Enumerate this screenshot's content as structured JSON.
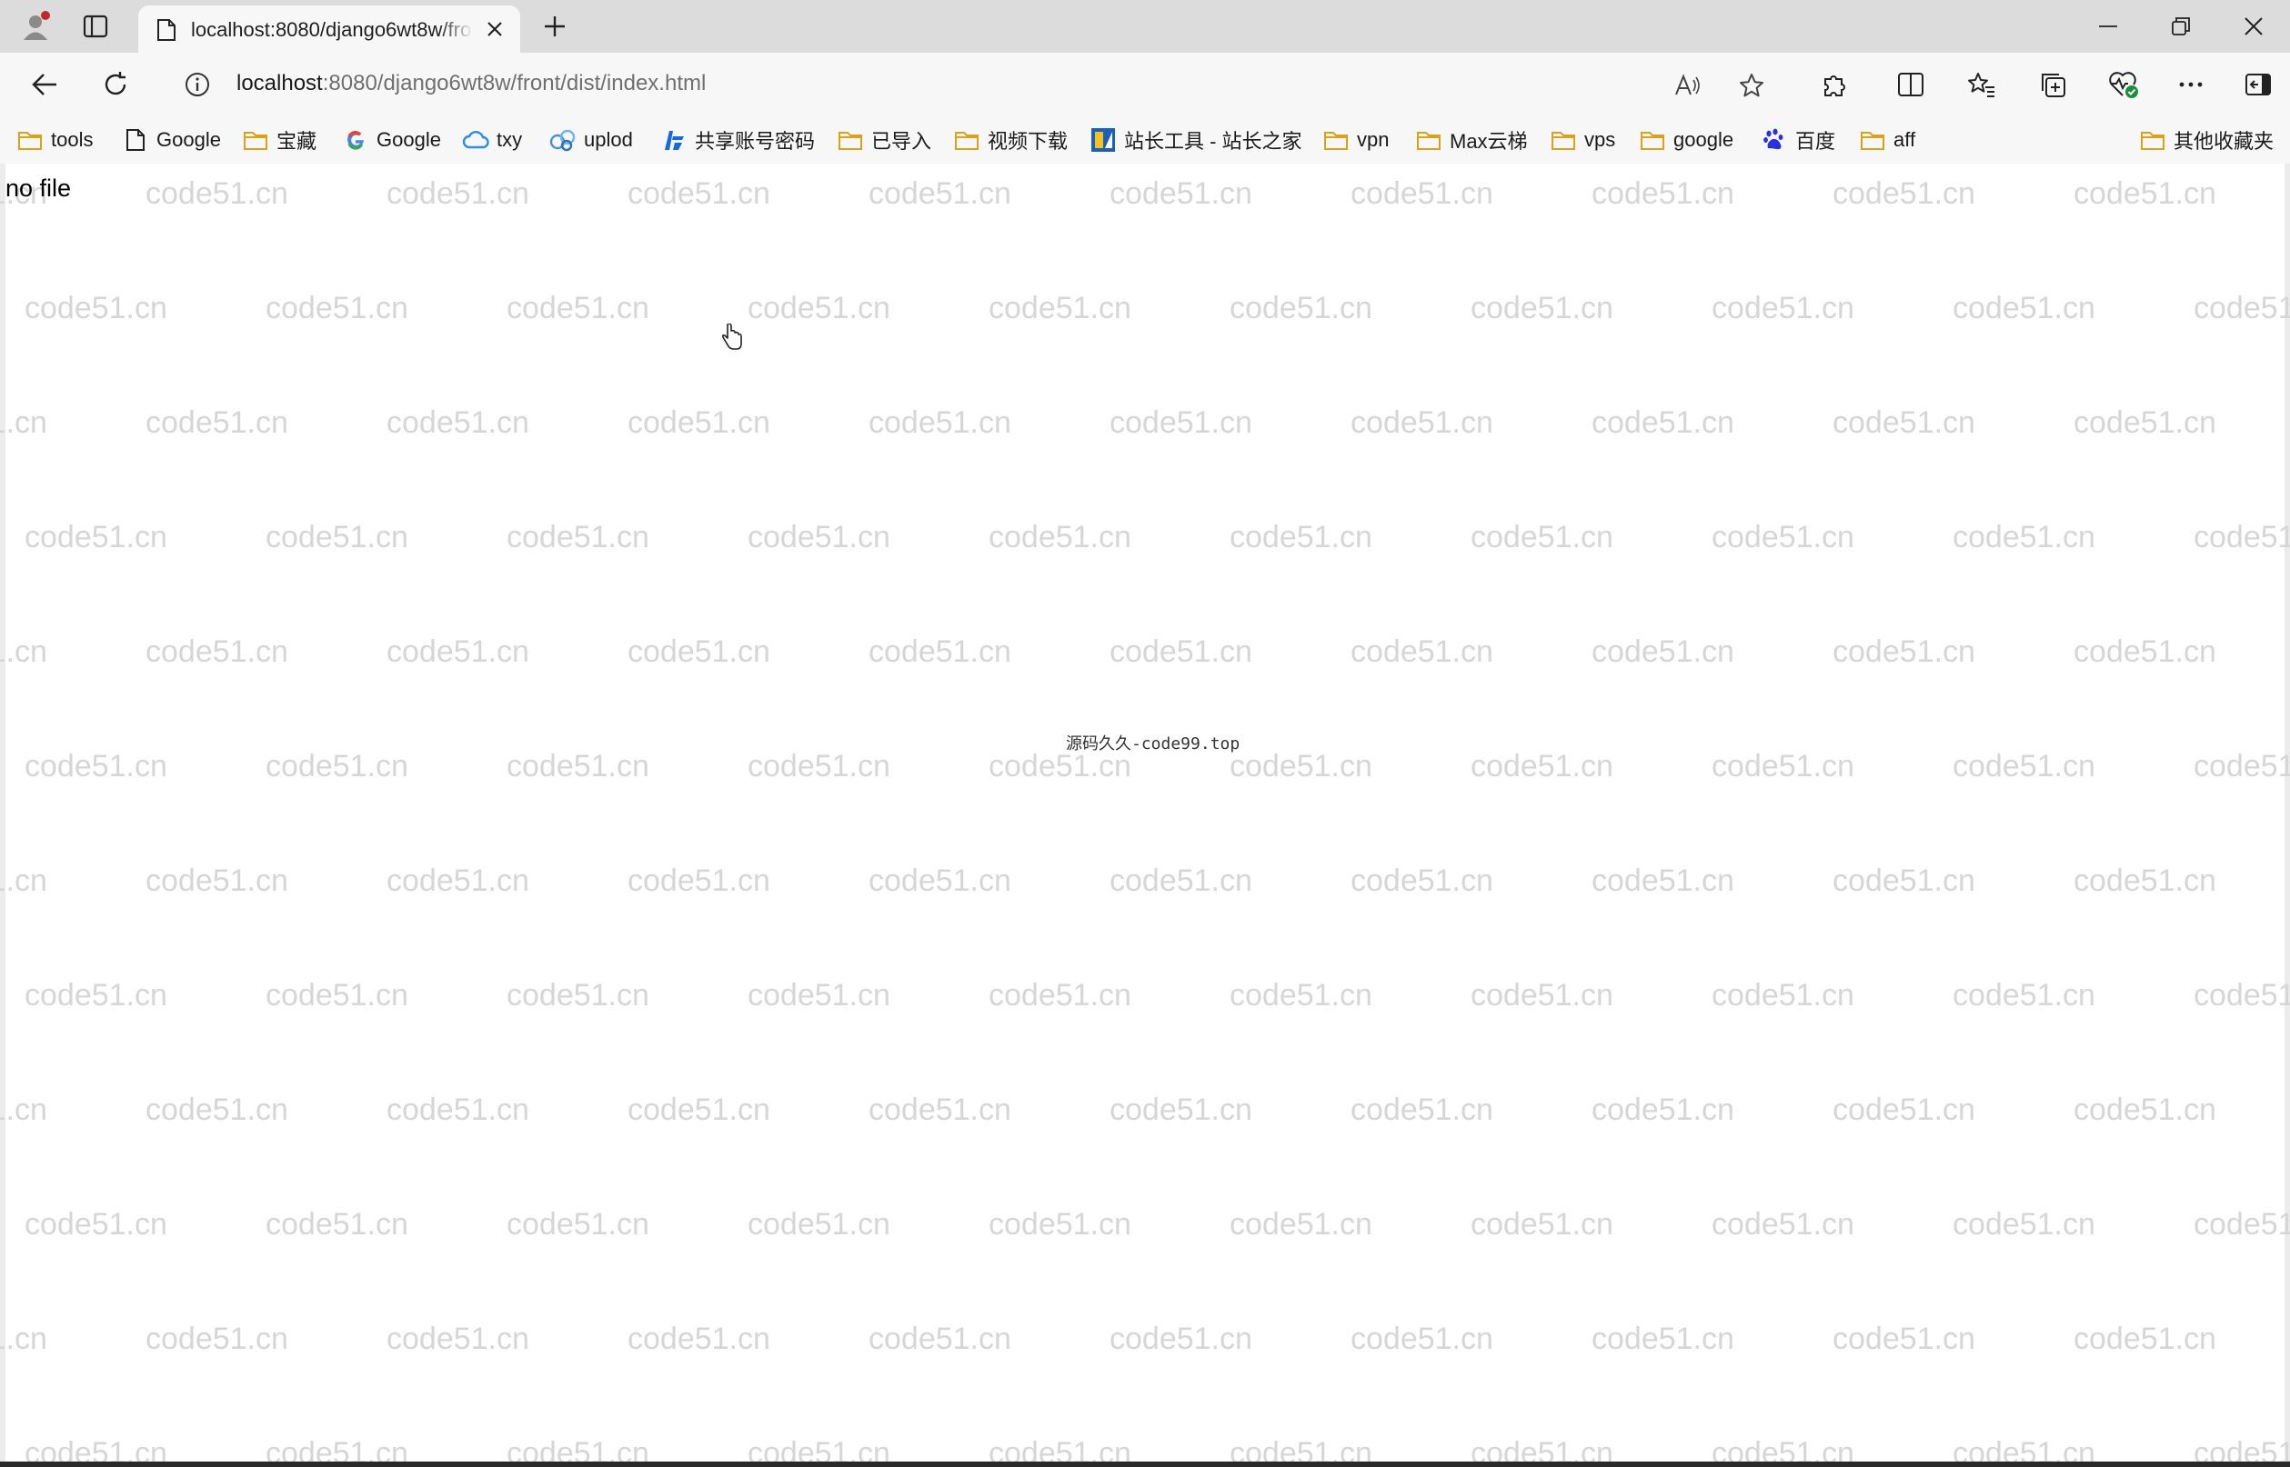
{
  "tab": {
    "title": "localhost:8080/django6wt8w/front/dist/index.html"
  },
  "address": {
    "host": "localhost",
    "path": ":8080/django6wt8w/front/dist/index.html"
  },
  "bookmarks": [
    {
      "label": "tools",
      "icon": "folder-icon"
    },
    {
      "label": "Google",
      "icon": "page-icon"
    },
    {
      "label": "宝藏",
      "icon": "folder-icon"
    },
    {
      "label": "Google",
      "icon": "google-icon"
    },
    {
      "label": "txy",
      "icon": "cloud-icon"
    },
    {
      "label": "uplod",
      "icon": "upload-icon"
    },
    {
      "label": "共享账号密码",
      "icon": "share-icon"
    },
    {
      "label": "已导入",
      "icon": "folder-icon"
    },
    {
      "label": "视频下载",
      "icon": "folder-icon"
    },
    {
      "label": "站长工具 - 站长之家",
      "icon": "chart-icon"
    },
    {
      "label": "vpn",
      "icon": "folder-icon"
    },
    {
      "label": "Max云梯",
      "icon": "folder-icon"
    },
    {
      "label": "vps",
      "icon": "folder-icon"
    },
    {
      "label": "google",
      "icon": "folder-icon"
    },
    {
      "label": "百度",
      "icon": "baidu-icon"
    },
    {
      "label": "aff",
      "icon": "folder-icon"
    }
  ],
  "other_bookmarks": "其他收藏夹",
  "page": {
    "message": "no file",
    "center_watermark": "源码久久-code99.top",
    "watermark": "code51.cn"
  },
  "colors": {
    "tab_strip": "#dcdcdc",
    "toolbar": "#f7f7f7",
    "folder": "#e8b730",
    "watermark": "#d6d6d6"
  }
}
